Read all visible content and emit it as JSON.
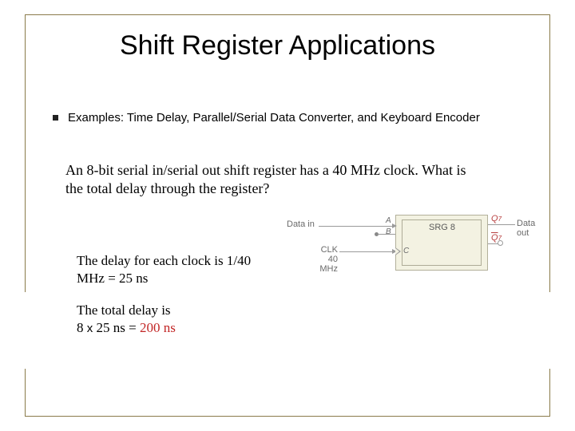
{
  "title": "Shift Register Applications",
  "bullet": "Examples: Time Delay, Parallel/Serial Data Converter, and Keyboard Encoder",
  "question": "An 8-bit serial in/serial out shift register has a 40 MHz clock. What is the total delay through the register?",
  "delay_per_clock_prefix": "The delay for each clock is 1/40 MHz = ",
  "delay_per_clock_value": "25 ns",
  "total_delay_prefix": "The total delay is",
  "total_delay_expr_a": "8 ",
  "total_delay_expr_x": "x",
  "total_delay_expr_b": " 25 ns = ",
  "total_delay_result": "200 ns",
  "diagram": {
    "data_in": "Data in",
    "a": "A",
    "b": "B",
    "clk_line1": "CLK",
    "clk_line2": "40 MHz",
    "c": "C",
    "srg": "SRG 8",
    "q7": "Q",
    "q7_sub": "7",
    "data_out": "Data out"
  }
}
